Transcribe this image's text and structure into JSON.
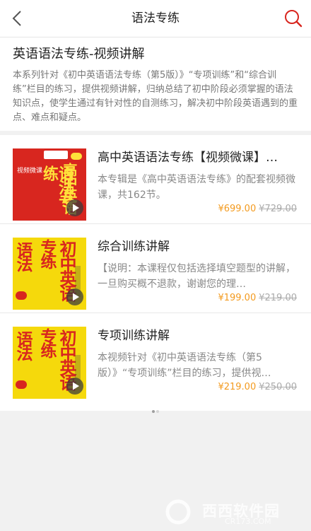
{
  "nav": {
    "title": "语法专练"
  },
  "intro": {
    "title": "英语语法专练-视频讲解",
    "description": "本系列针对《初中英语语法专练（第5版）》“专项训练”和“综合训练”栏目的练习，提供视频讲解，归纳总结了初中阶段必须掌握的语法知识点，使学生通过有针对性的自测练习，解决初中阶段英语遇到的重点、难点和疑点。"
  },
  "courses": [
    {
      "title": "高中英语语法专练【视频微课】…",
      "description": "本专辑是《高中英语语法专练》的配套视频微课，共162节。",
      "price": "¥699.00",
      "original_price": "¥729.00",
      "cover": {
        "style": "red",
        "tag": "视频微课",
        "chars_left": "语法专练",
        "chars_right": "高中英语"
      }
    },
    {
      "title": "综合训练讲解",
      "description": "【说明：本课程仅包括选择填空题型的讲解，一旦购买概不退款，谢谢您的理…",
      "price": "¥199.00",
      "original_price": "¥219.00",
      "cover": {
        "style": "yellow",
        "chars_a": "语法",
        "chars_b": "专练",
        "chars_c": "初中英语"
      }
    },
    {
      "title": "专项训练讲解",
      "description": "本视频针对《初中英语语法专练（第5版）》“专项训练”栏目的练习，提供视…",
      "price": "¥219.00",
      "original_price": "¥250.00",
      "cover": {
        "style": "yellow",
        "chars_a": "语法",
        "chars_b": "专练",
        "chars_c": "初中英语"
      }
    }
  ],
  "pagination": {
    "dots": 2,
    "active": 0
  },
  "watermark": {
    "text": "西西软件园",
    "sub": "CR173.COM"
  },
  "colors": {
    "accent_red": "#d8261f",
    "price": "#f39a1e",
    "cover_yellow": "#f5d90c"
  }
}
